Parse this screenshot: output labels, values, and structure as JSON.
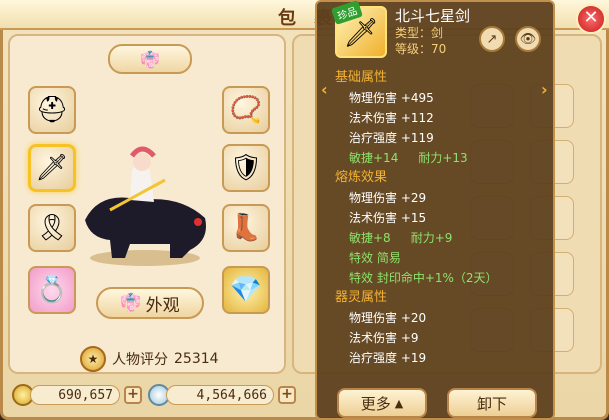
{
  "window": {
    "title": "包 裹"
  },
  "left": {
    "avatar_tab_icon": "robe-icon",
    "appearance_button": "外观",
    "score_label": "人物评分",
    "score_value": "25314"
  },
  "currency": {
    "gold": "690,657",
    "silver": "4,564,666"
  },
  "tooltip": {
    "badge": "珍品",
    "item_name": "北斗七星剑",
    "item_type": "类型：剑",
    "item_level": "等级：70",
    "sections": {
      "base": {
        "title": "基础属性",
        "physical_dmg": "物理伤害 +495",
        "magic_dmg": "法术伤害 +112",
        "heal": "治疗强度 +119",
        "agility": "敏捷+14",
        "stamina": "耐力+13"
      },
      "refine": {
        "title": "熔炼效果",
        "physical_dmg": "物理伤害 +29",
        "magic_dmg": "法术伤害 +15",
        "agility": "敏捷+8",
        "stamina": "耐力+9",
        "effect1": "特效 简易",
        "effect2": "特效 封印命中+1%（2天）"
      },
      "spirit": {
        "title": "器灵属性",
        "physical_dmg": "物理伤害 +20",
        "magic_dmg": "法术伤害 +9",
        "heal": "治疗强度 +19"
      }
    },
    "more_button": "更多",
    "unequip_button": "卸下"
  },
  "colors": {
    "accent_gold": "#f4b232",
    "stat_green": "#8ee36c",
    "panel_brown": "#5e401e"
  }
}
